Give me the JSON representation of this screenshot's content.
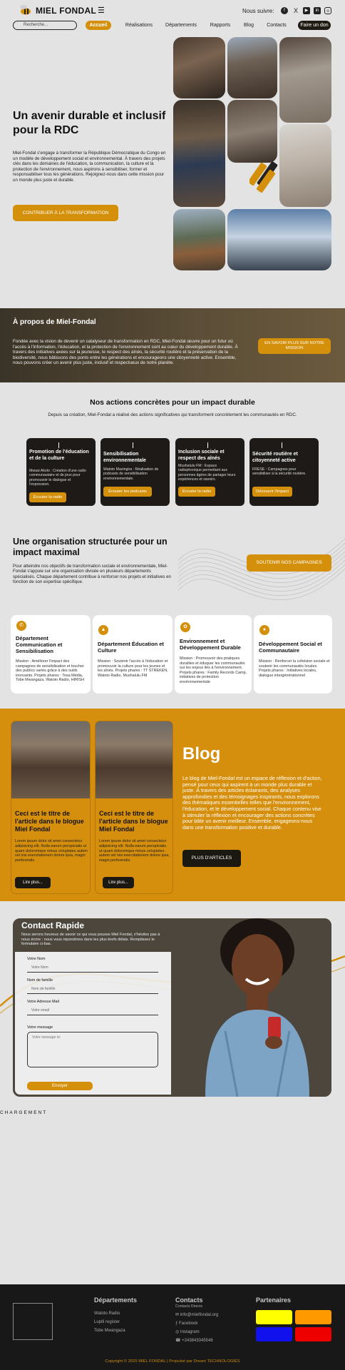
{
  "header": {
    "brand": "MIEL FONDAL",
    "follow_label": "Nous suivre:",
    "search_placeholder": "Recherche...",
    "nav": [
      "Accueil",
      "Réalisations",
      "Départements",
      "Rapports",
      "Blog",
      "Contacts"
    ],
    "donate_label": "Faire un don",
    "social_icons": [
      "facebook-icon",
      "x-icon",
      "youtube-icon",
      "linkedin-icon",
      "instagram-icon"
    ]
  },
  "hero": {
    "title": "Un avenir durable et inclusif pour la RDC",
    "text": "Miel-Fondal s'engage à transformer la République Démocratique du Congo en un modèle de développement social et environnemental. À travers des projets clés dans les domaines de l'éducation, la communication, la culture et la protection de l'environnement, nous aspirons à sensibiliser, former et responsabiliser tous les générations. Rejoignez-nous dans cette mission pour un monde plus juste et durable.",
    "button": "CONTRIBUER À LA TRANSFORMATION"
  },
  "about": {
    "title": "À propos de Miel-Fondal",
    "text": "Fondée avec la vision de devenir un catalyseur de transformation en RDC, Miel-Fondal œuvre pour un futur où l'accès à l'information, l'éducation, et la protection de l'environnement sont au cœur du développement durable. À travers des initiatives axées sur la jeunesse, le respect des aînés, la sécurité routière et la préservation de la biodiversité, nous bâtissons des ponts entre les générations et encourageons une citoyenneté active. Ensemble, nous pouvons créer un avenir plus juste, inclusif et respectueux de notre planète.",
    "button": "EN SAVOIR PLUS SUR NOTRE MISSION"
  },
  "actions": {
    "title": "Nos actions concrètes pour un impact durable",
    "subtitle": "Depuis sa création, Miel-Fondal a réalisé des actions significatives qui transforment concrètement les communautés en RDC.",
    "cards": [
      {
        "title": "Promotion de l'éducation et de la culture",
        "text": "Mwasi Akolo : Création d'une radio communautaire et de jeux pour promouvoir le dialogue et l'expression.",
        "button": "Écouter la radio"
      },
      {
        "title": "Sensibilisation environnementale",
        "text": "Watoto Mazingira : Réalisation de podcasts de sensibilisation environnementale.",
        "button": "Écouter les podcasts"
      },
      {
        "title": "Inclusion sociale et respect des aînés",
        "text": "Mushalulu FM : Espace radiophonique permettant aux personnes âgées de partager leurs expériences et savoirs.",
        "button": "Écouter la radio"
      },
      {
        "title": "Sécurité routière et citoyenneté active",
        "text": "FRESE : Campagnes pour sensibiliser à la sécurité routière.",
        "button": "Découvrir l'impact"
      }
    ]
  },
  "organisation": {
    "title": "Une organisation structurée pour un impact maximal",
    "text": "Pour atteindre nos objectifs de transformation sociale et environnementale, Miel-Fondal s'appuie sur une organisation divisée en plusieurs départements spécialisés. Chaque département contribue à renforcer nos projets et initiatives en fonction de son expertise spécifique.",
    "button": "SOUTENIR NOS CAMPAGNES",
    "departments": [
      {
        "title": "Département Communication et Sensibilisation",
        "text": "Mission : Améliorer l'impact des campagnes de sensibilisation et toucher des publics variés grâce à des outils innovants. Projets phares : Tosa Média, Tobe Mwangaza, Watoto Radio, HIRISH"
      },
      {
        "title": "Département Éducation et Culture",
        "text": "Mission : Soutenir l'accès à l'éducation et promouvoir la culture pour les jeunes et les aînés. Projets phares : TT STREKEN, Watoto Radio, Mushalulu FM"
      },
      {
        "title": "Environnement et Développement Durable",
        "text": "Mission : Promouvoir des pratiques durables et éduquer les communautés sur les enjeux liés à l'environnement. Projets phares : Family Records Camp, initiatives de protection environnementale"
      },
      {
        "title": "Développement Social et Communautaire",
        "text": "Mission : Renforcer la cohésion sociale et soutenir les communautés locales. Projets phares : Initiatives locales, dialogue intergénérationnel"
      }
    ]
  },
  "blog": {
    "title": "Blog",
    "text": "Le blog de Miel-Fondal est un espace de réflexion et d'action, pensé pour ceux qui aspirent à un monde plus durable et juste. À travers des articles éclairants, des analyses approfondies et des témoignages inspirants, nous explorons des thématiques essentielles telles que l'environnement, l'éducation, et le développement social. Chaque contenu vise à stimuler la réflexion et encourager des actions concrètes pour bâtir un avenir meilleur. Ensemble, engageons-nous dans une transformation positive et durable.",
    "button": "PLUS D'ARTICLES",
    "posts": [
      {
        "title": "Ceci est le titre de l'article dans le blogue Miel Fondal",
        "text": "Lorem ipsum dolor sit amet consectetur adipisicing elit. Nulla earum perspiciatis ut quam doloremque minus voluptates autem vel nisi exercitationem dolore ipsa, magni perferendis.",
        "button": "Lire plus..."
      },
      {
        "title": "Ceci est le titre de l'article dans le blogue Miel Fondal",
        "text": "Lorem ipsum dolor sit amet consectetur adipisicing elit. Nulla earum perspiciatis ut quam doloremque minus voluptates autem vel nisi exercitationem dolore ipsa, magni perferendis.",
        "button": "Lire plus..."
      }
    ]
  },
  "contact": {
    "title": "Contact Rapide",
    "intro": "Nous serons heureux de savoir ce qui vous pousse Miel Fondal, n'hésitez pas à nous écrire : nous vous répondrons dans les plus brefs délais. Remplissez le formulaire ci-bas.",
    "fields": [
      {
        "label": "Votre Nom",
        "placeholder": "Votre Nom"
      },
      {
        "label": "Nom de famille",
        "placeholder": "Nom de famille"
      },
      {
        "label": "Votre Adresse Mail",
        "placeholder": "Votre email"
      }
    ],
    "message_label": "Votre message",
    "message_placeholder": "Votre message ici",
    "submit": "Envoyer",
    "loading_text": "CHARGEMENT"
  },
  "footer": {
    "departments_title": "Départements",
    "departments": [
      "Watoto Radio",
      "Lupiti register",
      "Tobe Mwangaza"
    ],
    "contacts_title": "Contacts",
    "contacts_subtitle": "Contacts Directs",
    "contacts": [
      "info@mielfondal.org",
      "Facebook",
      "Instagram",
      "+243843345546"
    ],
    "partners_title": "Partenaires",
    "partner_colors": [
      "#ffff00",
      "#ff9900",
      "#1111ee",
      "#ee0000"
    ],
    "copyright": "Copyright © 2025 MIEL FONDAL | Propulsé par Dream TECHNOLOGIES"
  },
  "colors": {
    "accent": "#d4900a",
    "dark": "#1d1a17",
    "background": "#e3e3e4"
  }
}
